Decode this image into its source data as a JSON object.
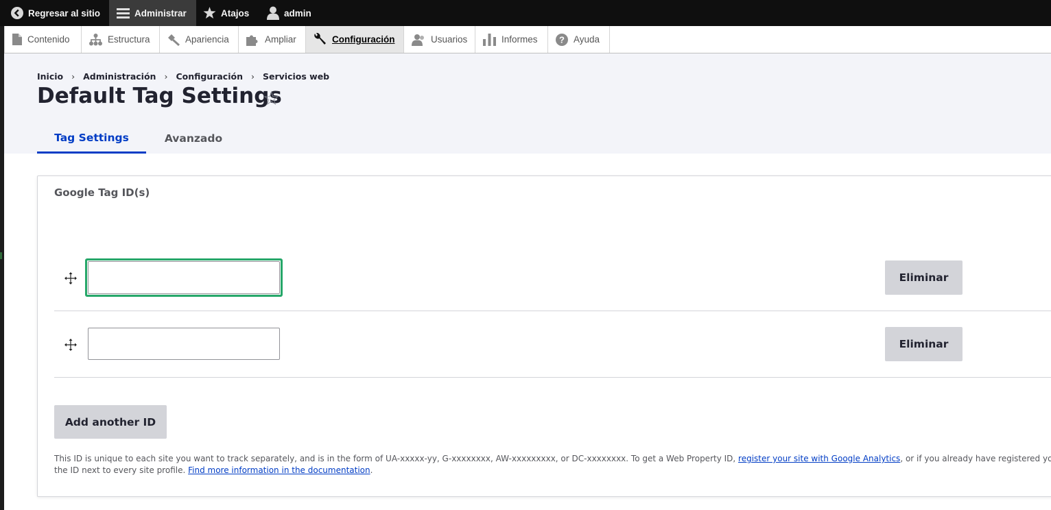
{
  "toolbar": {
    "back_label": "Regresar al sitio",
    "manage_label": "Administrar",
    "shortcuts_label": "Atajos",
    "user_label": "admin"
  },
  "tray": {
    "items": [
      {
        "label": "Contenido",
        "icon": "file-icon"
      },
      {
        "label": "Estructura",
        "icon": "sitemap-icon"
      },
      {
        "label": "Apariencia",
        "icon": "paintbrush-icon"
      },
      {
        "label": "Ampliar",
        "icon": "puzzle-icon"
      },
      {
        "label": "Configuración",
        "icon": "wrench-icon",
        "active": true
      },
      {
        "label": "Usuarios",
        "icon": "people-icon"
      },
      {
        "label": "Informes",
        "icon": "bar-chart-icon"
      },
      {
        "label": "Ayuda",
        "icon": "help-icon"
      }
    ]
  },
  "breadcrumb": [
    "Inicio",
    "Administración",
    "Configuración",
    "Servicios web"
  ],
  "breadcrumb_sep": "›",
  "page": {
    "title": "Default Tag Settings",
    "star": "☆"
  },
  "tabs": [
    {
      "label": "Tag Settings",
      "active": true
    },
    {
      "label": "Avanzado",
      "active": false
    }
  ],
  "form": {
    "legend": "Google Tag ID(s)",
    "rows": [
      {
        "value": "",
        "remove_label": "Eliminar",
        "focused": true
      },
      {
        "value": "",
        "remove_label": "Eliminar",
        "focused": false
      }
    ],
    "add_label": "Add another ID",
    "description": {
      "part1": "This ID is unique to each site you want to track separately, and is in the form of UA-xxxxx-yy, G-xxxxxxxx, AW-xxxxxxxxx, or DC-xxxxxxxx. To get a Web Property ID, ",
      "link1": "register your site with Google Analytics",
      "part2": ", or if you already have registered your site, go to you",
      "part3": "the ID next to every site profile. ",
      "link2": "Find more information in the documentation",
      "part4": "."
    }
  },
  "colors": {
    "toolbar_bg": "#0f0f0f",
    "accent": "#003cc5",
    "focus": "#26a769",
    "button_bg": "#d3d4d9"
  }
}
